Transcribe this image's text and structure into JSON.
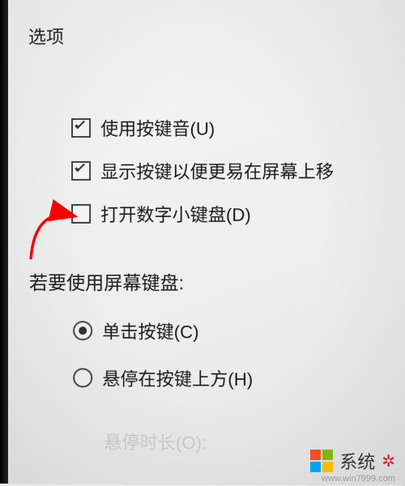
{
  "title": "选项",
  "checkboxes": [
    {
      "label": "使用按键音(U)",
      "checked": true
    },
    {
      "label": "显示按键以便更易在屏幕上移",
      "checked": true
    },
    {
      "label": "打开数字小键盘(D)",
      "checked": false
    }
  ],
  "section_label": "若要使用屏幕键盘:",
  "radios": [
    {
      "label": "单击按键(C)",
      "checked": true
    },
    {
      "label": "悬停在按键上方(H)",
      "checked": false
    }
  ],
  "faded_label": "悬停时长(O):",
  "watermark": {
    "site": "系统",
    "domain": "www.win7999.com"
  }
}
